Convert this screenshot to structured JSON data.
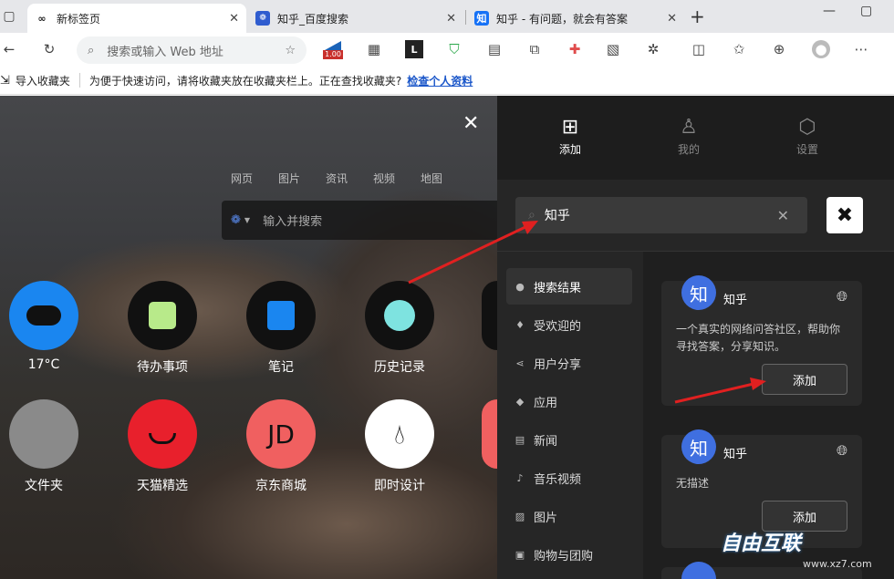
{
  "tabs": [
    {
      "icon": "infinity-icon",
      "title": "新标签页",
      "active": true
    },
    {
      "icon": "baidu-paw-icon",
      "title": "知乎_百度搜索",
      "active": false
    },
    {
      "icon": "zhihu-icon",
      "icon_text": "知",
      "title": "知乎 - 有问题，就会有答案",
      "active": false
    }
  ],
  "new_tab": "+",
  "address": {
    "placeholder": "搜索或输入 Web 地址"
  },
  "badge": "1.00",
  "favbar": {
    "import": "导入收藏夹",
    "hint": "为便于快速访问，请将收藏夹放在收藏夹栏上。正在查找收藏夹?",
    "link": "检查个人资料"
  },
  "newtab": {
    "search_tabs": [
      "网页",
      "图片",
      "资讯",
      "视频",
      "地图"
    ],
    "search_placeholder": "输入并搜索",
    "tiles_row1": [
      {
        "label": "17°C"
      },
      {
        "label": "待办事项"
      },
      {
        "label": "笔记"
      },
      {
        "label": "历史记录"
      }
    ],
    "tiles_row2": [
      {
        "label": "文件夹"
      },
      {
        "label": "天猫精选"
      },
      {
        "label": "京东商城",
        "logo_text": "JD"
      },
      {
        "label": "即时设计"
      }
    ]
  },
  "panel": {
    "tabs": [
      {
        "icon": "add-square-icon",
        "label": "添加",
        "active": true
      },
      {
        "icon": "user-icon",
        "label": "我的",
        "active": false
      },
      {
        "icon": "settings-hex-icon",
        "label": "设置",
        "active": false
      }
    ],
    "search_value": "知乎",
    "sidebar": [
      {
        "label": "搜索结果",
        "active": true
      },
      {
        "label": "受欢迎的",
        "active": false
      },
      {
        "label": "用户分享",
        "active": false
      },
      {
        "label": "应用",
        "active": false
      },
      {
        "label": "新闻",
        "active": false
      },
      {
        "label": "音乐视频",
        "active": false
      },
      {
        "label": "图片",
        "active": false
      },
      {
        "label": "购物与团购",
        "active": false
      }
    ],
    "results": [
      {
        "logo": "知",
        "name": "知乎",
        "desc": "一个真实的网络问答社区，帮助你寻找答案，分享知识。",
        "button": "添加"
      },
      {
        "logo": "知",
        "name": "知乎",
        "desc": "无描述",
        "button": "添加"
      }
    ]
  },
  "watermark": {
    "text": "自由互联",
    "url": "www.xz7.com"
  },
  "colors": {
    "accent_blue": "#3f6fe0",
    "arrow_red": "#e02020"
  }
}
